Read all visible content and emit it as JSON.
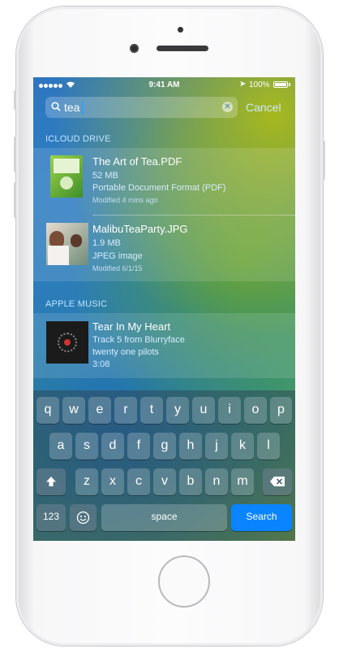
{
  "status_bar": {
    "time": "9:41 AM",
    "battery": "100%"
  },
  "search": {
    "query": "tea",
    "cancel_label": "Cancel"
  },
  "sections": {
    "icloud": "ICLOUD DRIVE",
    "music": "APPLE MUSIC"
  },
  "results": {
    "pdf": {
      "title": "The Art of Tea.PDF",
      "size": "52 MB",
      "type": "Portable Document Format (PDF)",
      "modified": "Modified 4 mins ago"
    },
    "jpg": {
      "title": "MalibuTeaParty.JPG",
      "size": "1.9 MB",
      "type": "JPEG image",
      "modified": "Modified 6/1/15"
    },
    "song": {
      "title": "Tear In My Heart",
      "track": "Track 5 from Blurryface",
      "artist": "twenty one pilots",
      "duration": "3:08"
    }
  },
  "keyboard": {
    "row1": [
      "q",
      "w",
      "e",
      "r",
      "t",
      "y",
      "u",
      "i",
      "o",
      "p"
    ],
    "row2": [
      "a",
      "s",
      "d",
      "f",
      "g",
      "h",
      "j",
      "k",
      "l"
    ],
    "row3": [
      "z",
      "x",
      "c",
      "v",
      "b",
      "n",
      "m"
    ],
    "numbers_label": "123",
    "space_label": "space",
    "search_label": "Search",
    "emoji_icon": "emoji-icon",
    "shift_icon": "shift-icon",
    "delete_icon": "delete-icon"
  },
  "colors": {
    "accent": "#0a84ff",
    "section_header": "#bfe4ff"
  }
}
